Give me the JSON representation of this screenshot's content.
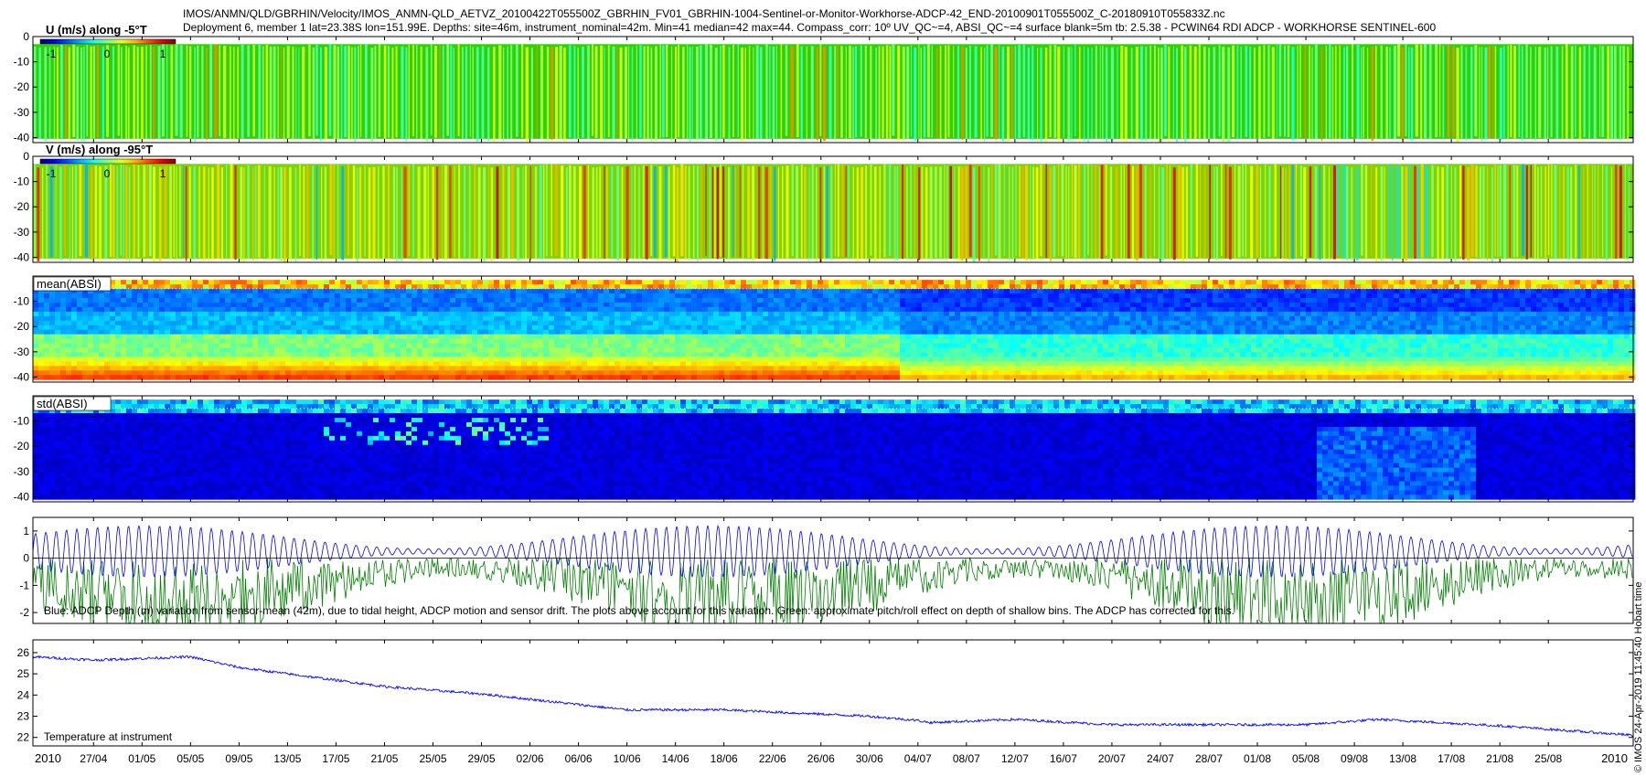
{
  "header": {
    "line1": "IMOS/ANMN/QLD/GBRHIN/Velocity/IMOS_ANMN-QLD_AETVZ_20100422T055500Z_GBRHIN_FV01_GBRHIN-1004-Sentinel-or-Monitor-Workhorse-ADCP-42_END-20100901T055500Z_C-20180910T055833Z.nc",
    "line2": "Deployment 6, member 1 lat=23.38S lon=151.99E. Depths: site=46m, instrument_nominal=42m. Min=41 median=42 max=44. Compass_corr: 10º UV_QC~=4, ABSI_QC~=4 surface blank=5m tb: 2.5.38 - PCWIN64 RDI ADCP - WORKHORSE SENTINEL-600"
  },
  "side_note": "© IMOS 24-Apr-2019 11:45:40 Hobart time",
  "colors": {
    "axis": "#000000",
    "blue_line": "#0000ff",
    "green_line": "#007f00",
    "dark_blue": "#00008b"
  },
  "chart_data": [
    {
      "type": "heatmap",
      "title": "U (m/s) along -5°T",
      "colorbar": {
        "ticks": [
          "-1",
          "0",
          "1"
        ],
        "range": [
          -1,
          1
        ]
      },
      "y_ticks": [
        "0",
        "-10",
        "-20",
        "-30",
        "-40"
      ],
      "ylim": [
        -42,
        0
      ],
      "dominant_color": "#34d400"
    },
    {
      "type": "heatmap",
      "title": "V (m/s) along -95°T",
      "colorbar": {
        "ticks": [
          "-1",
          "0",
          "1"
        ],
        "range": [
          -1,
          1
        ]
      },
      "y_ticks": [
        "0",
        "-10",
        "-20",
        "-30",
        "-40"
      ],
      "ylim": [
        -42,
        0
      ],
      "dominant_color": "#7ed800"
    },
    {
      "type": "heatmap",
      "title": "mean(ABSI)",
      "y_ticks": [
        "-10",
        "-20",
        "-30",
        "-40"
      ],
      "ylim": [
        -42,
        0
      ]
    },
    {
      "type": "heatmap",
      "title": "std(ABSI)",
      "y_ticks": [
        "-10",
        "-20",
        "-30",
        "-40"
      ],
      "ylim": [
        -42,
        0
      ]
    },
    {
      "type": "line",
      "annotation": "Blue: ADCP Depth (m) variation from sensor-mean (42m), due to tidal height, ADCP motion and sensor drift. The plots above account for this variation. Green: approximate pitch/roll effect on depth of shallow bins. The ADCP has corrected for this.",
      "y_ticks": [
        "1",
        "0",
        "-1",
        "-2"
      ],
      "ylim": [
        -2.4,
        1.5
      ],
      "series_colors": [
        "#0000ff",
        "#007f00"
      ]
    },
    {
      "type": "line",
      "annotation": "Temperature at instrument",
      "y_ticks": [
        "26",
        "25",
        "24",
        "23",
        "22"
      ],
      "ylim": [
        21.6,
        26.6
      ],
      "x": [
        "2010-04-22",
        "2010-04-27",
        "2010-05-05",
        "2010-05-09",
        "2010-05-21",
        "2010-05-29",
        "2010-06-10",
        "2010-06-18",
        "2010-06-30",
        "2010-07-04",
        "2010-07-05",
        "2010-07-12",
        "2010-07-20",
        "2010-07-28",
        "2010-08-05",
        "2010-08-11",
        "2010-08-21",
        "2010-09-01"
      ],
      "values": [
        25.8,
        25.65,
        25.8,
        25.3,
        24.4,
        24.05,
        23.3,
        23.3,
        23.0,
        22.8,
        22.7,
        22.85,
        22.6,
        22.6,
        22.6,
        22.85,
        22.55,
        22.1
      ]
    }
  ],
  "x_axis": {
    "year_label": "2010",
    "year_label_end": "2010",
    "ticks": [
      "27/04",
      "01/05",
      "05/05",
      "09/05",
      "13/05",
      "17/05",
      "21/05",
      "25/05",
      "29/05",
      "02/06",
      "06/06",
      "10/06",
      "14/06",
      "18/06",
      "22/06",
      "26/06",
      "30/06",
      "04/07",
      "08/07",
      "12/07",
      "16/07",
      "20/07",
      "24/07",
      "28/07",
      "01/08",
      "05/08",
      "09/08",
      "13/08",
      "17/08",
      "21/08",
      "25/08"
    ]
  }
}
